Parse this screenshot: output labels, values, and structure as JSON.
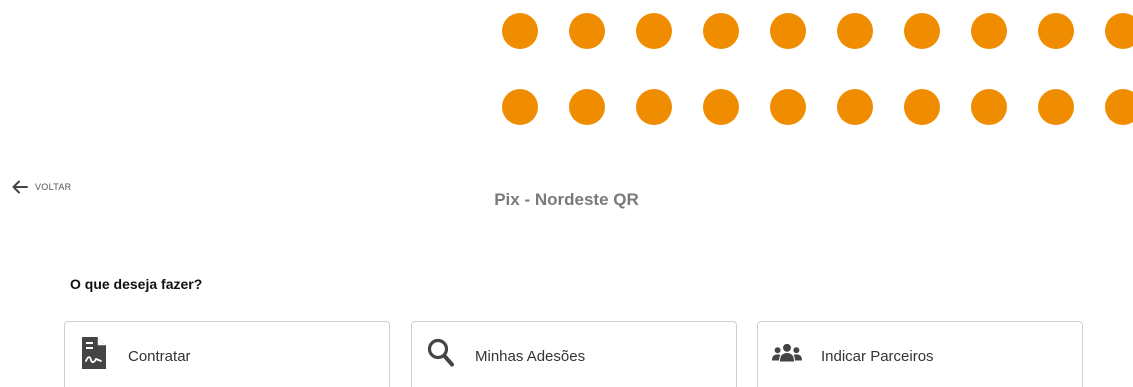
{
  "colors": {
    "dot": "#f08c00",
    "icon": "#444444"
  },
  "dot_pattern": {
    "rows": 2,
    "columns": 10
  },
  "nav": {
    "back_label": "VOLTAR",
    "back_icon": "arrow-left-icon"
  },
  "header": {
    "title": "Pix - Nordeste QR"
  },
  "main": {
    "question": "O que deseja fazer?",
    "cards": [
      {
        "label": "Contratar",
        "icon": "contract-document-icon"
      },
      {
        "label": "Minhas Adesões",
        "icon": "search-icon"
      },
      {
        "label": "Indicar Parceiros",
        "icon": "users-group-icon"
      }
    ]
  }
}
